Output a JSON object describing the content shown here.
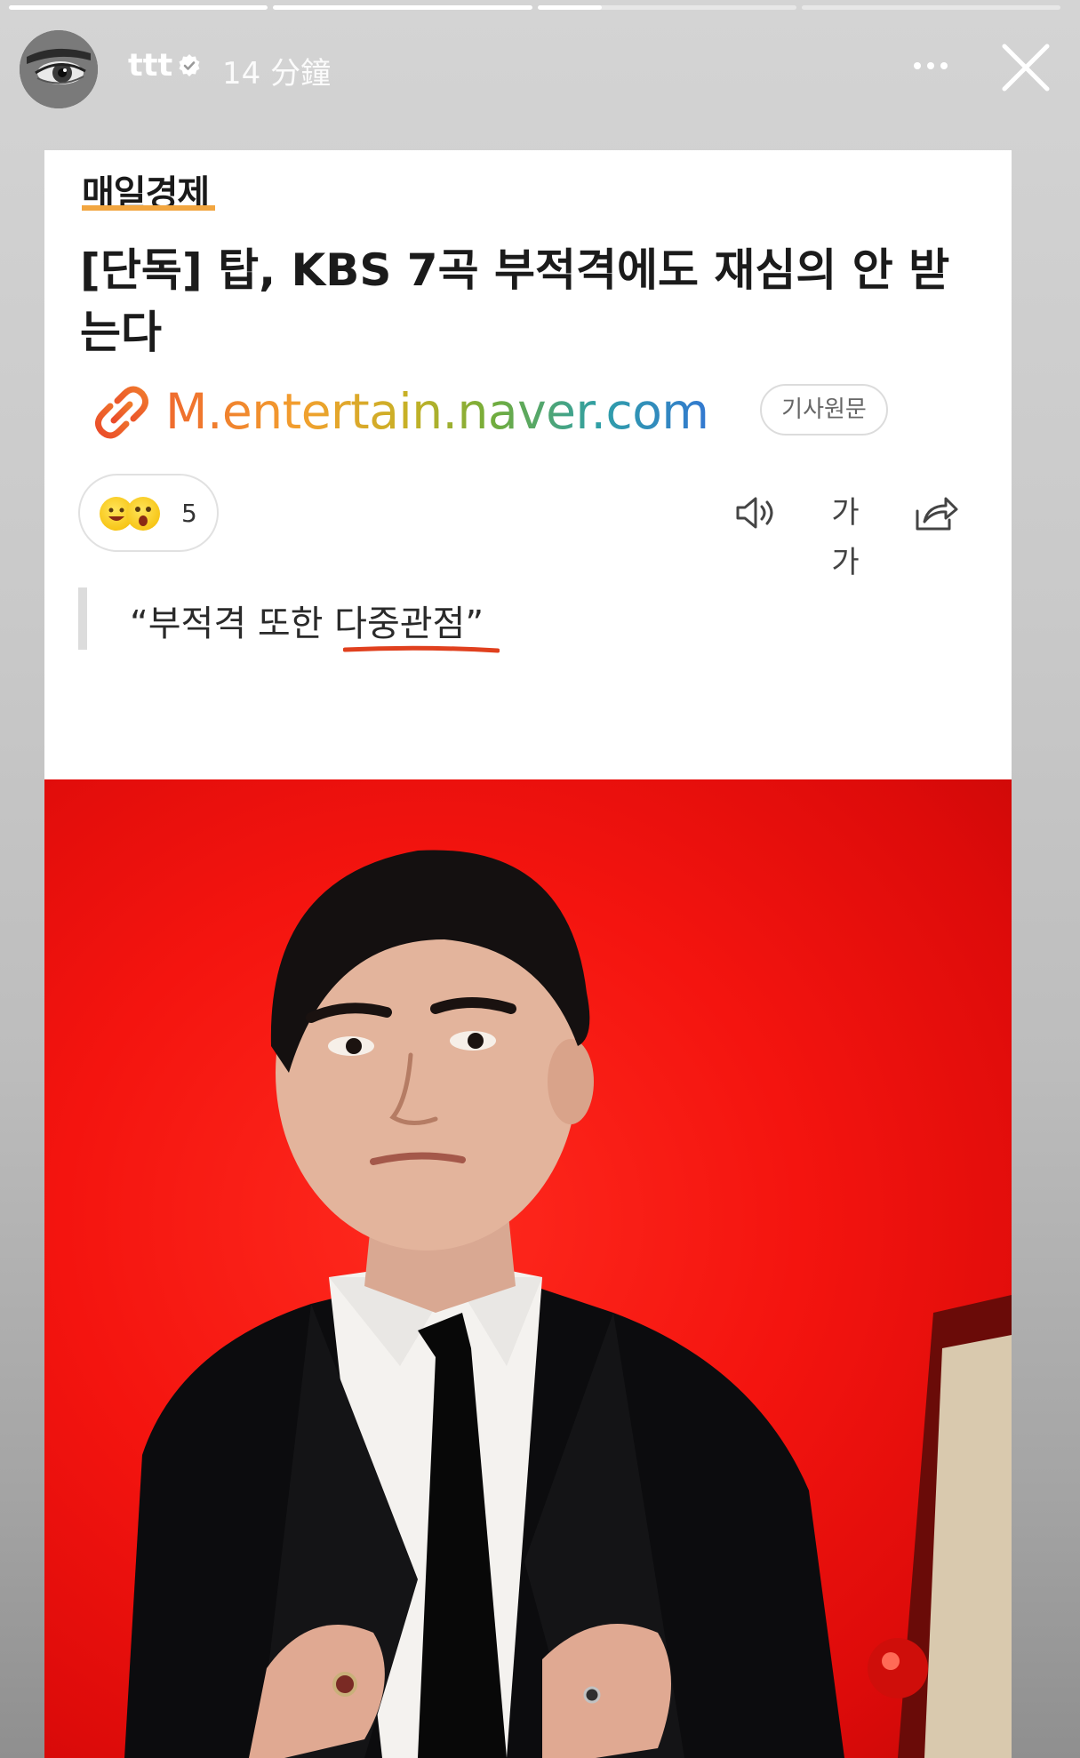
{
  "story": {
    "progress": [
      1.0,
      1.0,
      0.25,
      0.0
    ],
    "username": "ttt",
    "time_ago": "14 分鐘"
  },
  "article": {
    "publisher": "매일경제",
    "headline": "[단독] 탑, KBS 7곡 부적격에도 재심의 안 받는다",
    "link_url": "M.entertain.naver.com",
    "original_button": "기사원문",
    "reaction_count": "5",
    "font_size_label": "가가",
    "quote_prefix": "“부적격 또한 ",
    "quote_highlight": "다중관점",
    "quote_suffix": "”"
  },
  "colors": {
    "publisher_accent": "#f2a640",
    "photo_background": "#f4140f",
    "quote_underline": "#e0401e"
  },
  "icons": [
    "avatar",
    "verified-icon",
    "more-icon",
    "close-icon",
    "link-icon",
    "speaker-icon",
    "font-size-icon",
    "share-icon"
  ]
}
